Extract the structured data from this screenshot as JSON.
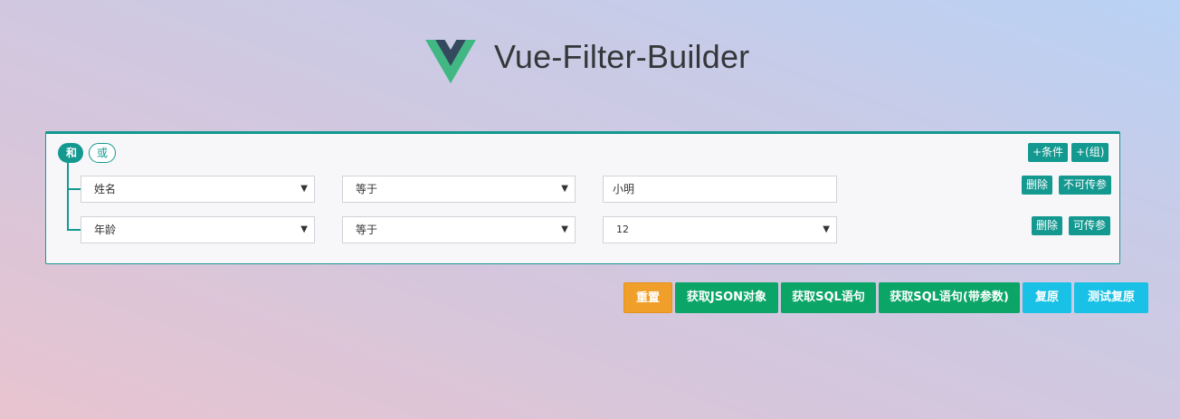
{
  "header": {
    "title": "Vue-Filter-Builder",
    "logo_icon": "vue-logo-icon"
  },
  "builder": {
    "logic": {
      "and_label": "和",
      "or_label": "或",
      "selected": "和"
    },
    "add_condition_label": "+条件",
    "add_group_label": "+(组)",
    "rows": [
      {
        "field": "姓名",
        "operator": "等于",
        "value": "小明",
        "value_type": "input",
        "delete_label": "删除",
        "param_label": "不可传参"
      },
      {
        "field": "年龄",
        "operator": "等于",
        "value": "12",
        "value_type": "select",
        "delete_label": "删除",
        "param_label": "可传参"
      }
    ]
  },
  "actions": {
    "reset": "重置",
    "get_json": "获取JSON对象",
    "get_sql": "获取SQL语句",
    "get_sql_params": "获取SQL语句(带参数)",
    "restore": "复原",
    "test_restore": "测试复原"
  },
  "colors": {
    "accent": "#149990",
    "reset": "#f0a02a",
    "green": "#0aa567",
    "cyan": "#18c1e5"
  }
}
